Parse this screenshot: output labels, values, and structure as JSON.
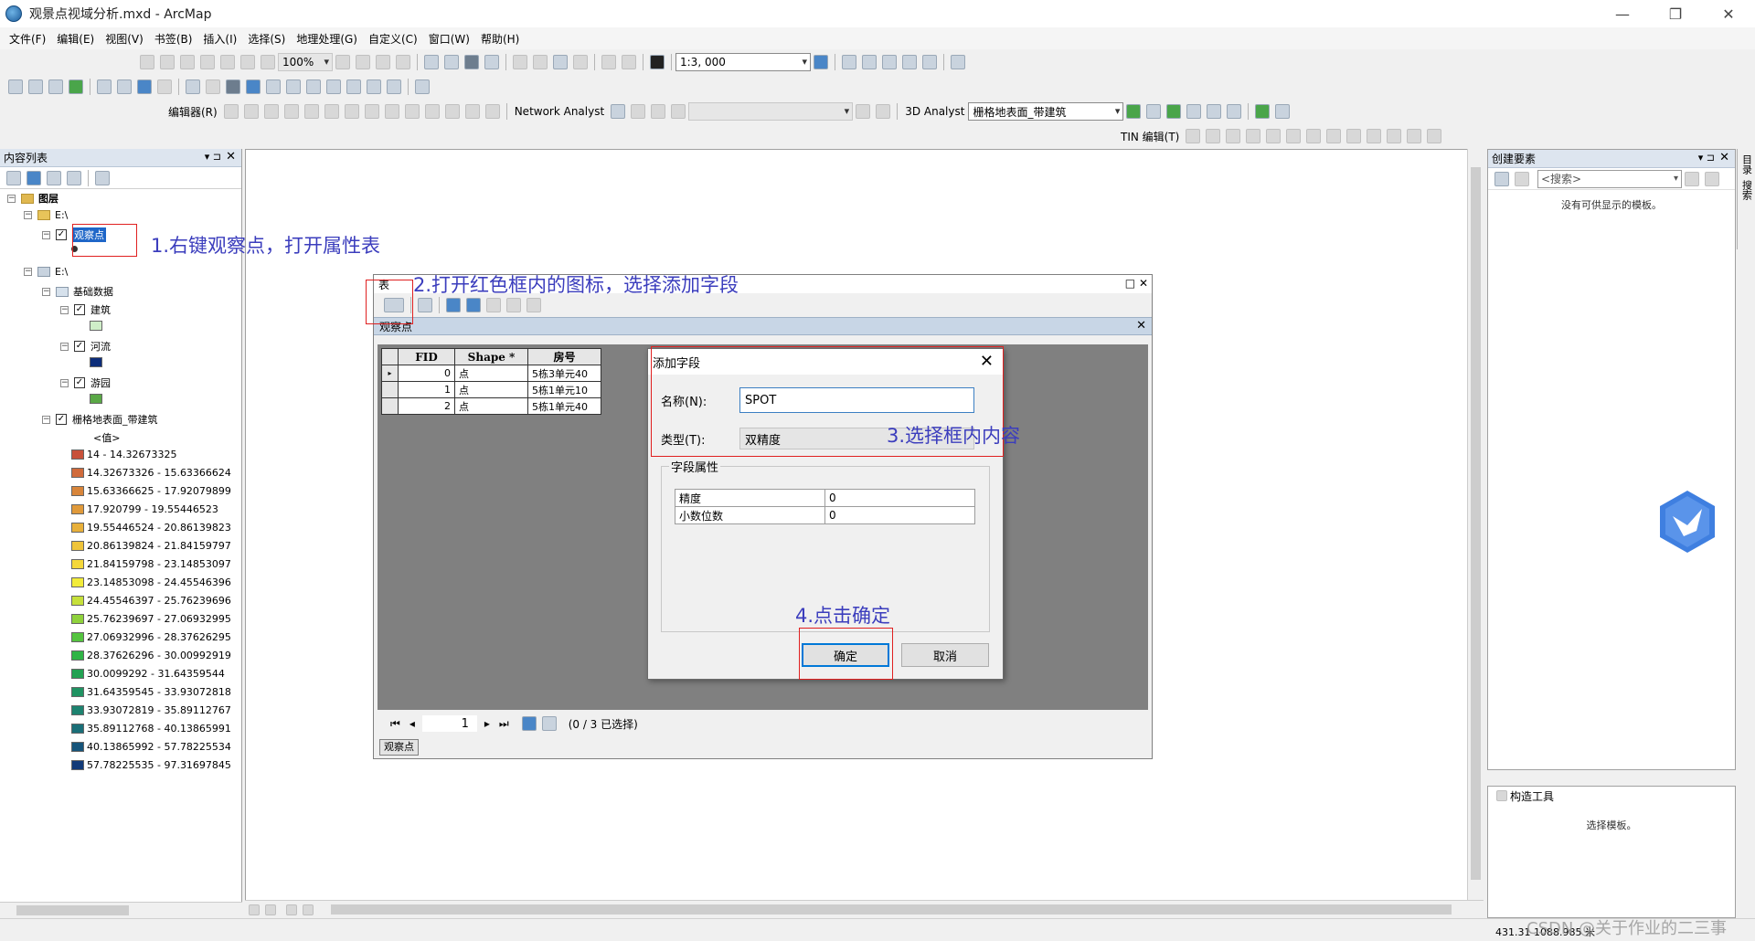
{
  "window": {
    "title": "观景点视域分析.mxd - ArcMap",
    "controls": [
      "—",
      "❐",
      "✕"
    ]
  },
  "menu": [
    "文件(F)",
    "编辑(E)",
    "视图(V)",
    "书签(B)",
    "插入(I)",
    "选择(S)",
    "地理处理(G)",
    "自定义(C)",
    "窗口(W)",
    "帮助(H)"
  ],
  "toolbar": {
    "zoom_value": "100%",
    "scale_value": "1:3, 000",
    "editor_label": "编辑器(R)",
    "network_analyst": "Network Analyst",
    "analyst_3d": "3D Analyst",
    "surface_layer": "栅格地表面_带建筑",
    "tin_edit": "TIN 编辑(T)"
  },
  "toc": {
    "title": "内容列表",
    "root": "图层",
    "drive1": "E:\\",
    "layer_observe": "观察点",
    "drive2": "E:\\",
    "group_basic": "基础数据",
    "layer_building": "建筑",
    "layer_river": "河流",
    "layer_park": "游园",
    "layer_raster": "栅格地表面_带建筑",
    "value_label": "<值>",
    "colors": {
      "building": "#cfeec8",
      "river": "#0d2d7a",
      "park": "#5aa846"
    },
    "legend": [
      {
        "label": "14 - 14.32673325",
        "color": "#c8513a"
      },
      {
        "label": "14.32673326 - 15.63366624",
        "color": "#d06a3a"
      },
      {
        "label": "15.63366625 - 17.92079899",
        "color": "#d8853a"
      },
      {
        "label": "17.920799 - 19.55446523",
        "color": "#e09a3a"
      },
      {
        "label": "19.55446524 - 20.86139823",
        "color": "#e8b03a"
      },
      {
        "label": "20.86139824 - 21.84159797",
        "color": "#efc43a"
      },
      {
        "label": "21.84159798 - 23.14853097",
        "color": "#f5d83a"
      },
      {
        "label": "23.14853098 - 24.45546396",
        "color": "#f2ec3a"
      },
      {
        "label": "24.45546397 - 25.76239696",
        "color": "#c6e03a"
      },
      {
        "label": "25.76239697 - 27.06932995",
        "color": "#8fd23c"
      },
      {
        "label": "27.06932996 - 28.37626295",
        "color": "#54c43f"
      },
      {
        "label": "28.37626296 - 30.00992919",
        "color": "#2fb446"
      },
      {
        "label": "30.0099292 - 31.64359544",
        "color": "#22a252"
      },
      {
        "label": "31.64359545 - 33.93072818",
        "color": "#1f9362"
      },
      {
        "label": "33.93072819 - 35.89112767",
        "color": "#1d8370"
      },
      {
        "label": "35.89112768 - 40.13865991",
        "color": "#1a6f78"
      },
      {
        "label": "40.13865992 - 57.78225534",
        "color": "#16547a"
      },
      {
        "label": "57.78225535 - 97.31697845",
        "color": "#123a78"
      }
    ]
  },
  "table_window": {
    "title": "表",
    "subtab": "观察点",
    "columns": [
      "FID",
      "Shape *",
      "房号"
    ],
    "rows": [
      {
        "fid": "0",
        "shape": "点",
        "room": "5栋3单元40"
      },
      {
        "fid": "1",
        "shape": "点",
        "room": "5栋1单元10"
      },
      {
        "fid": "2",
        "shape": "点",
        "room": "5栋1单元40"
      }
    ],
    "page": "1",
    "selection": "(0 / 3 已选择)",
    "bottom_tab": "观察点"
  },
  "dialog": {
    "title": "添加字段",
    "name_label": "名称(N):",
    "name_value": "SPOT",
    "type_label": "类型(T):",
    "type_value": "双精度",
    "group_title": "字段属性",
    "props": [
      {
        "key": "精度",
        "value": "0"
      },
      {
        "key": "小数位数",
        "value": "0"
      }
    ],
    "ok": "确定",
    "cancel": "取消"
  },
  "create_features": {
    "title": "创建要素",
    "search_placeholder": "<搜索>",
    "empty": "没有可供显示的模板。"
  },
  "construct_tools": {
    "title": "构造工具",
    "hint": "选择模板。"
  },
  "side_tabs": [
    "目录",
    "搜索"
  ],
  "annotations": {
    "step1": "1.右键观察点，打开属性表",
    "step2": "2.打开红色框内的图标，选择添加字段",
    "step3": "3.选择框内内容",
    "step4": "4.点击确定"
  },
  "status": {
    "coords": "431.31  1088.985 米",
    "watermark": "CSDN @关于作业的二三事"
  }
}
